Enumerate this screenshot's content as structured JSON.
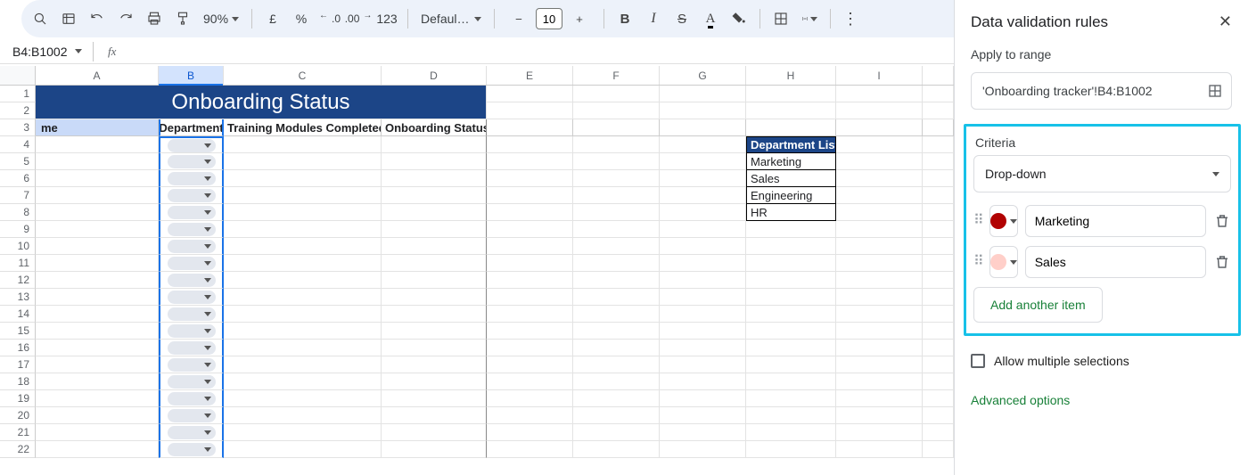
{
  "toolbar": {
    "zoom": "90%",
    "currency": "£",
    "percent": "%",
    "dec_dec": ".0",
    "dec_inc": ".00",
    "numfmt": "123",
    "font": "Defaul…",
    "font_size": "10"
  },
  "namebox": "B4:B1002",
  "sheet": {
    "columns": [
      "A",
      "B",
      "C",
      "D",
      "E",
      "F",
      "G",
      "H",
      "I"
    ],
    "selected_col": "B",
    "title": "Onboarding Status",
    "headers": {
      "a": "me",
      "b": "Department",
      "c": "Training Modules Completed",
      "d": "Onboarding Status"
    },
    "dept_list_header": "Department List",
    "dept_list": [
      "Marketing",
      "Sales",
      "Engineering",
      "HR"
    ]
  },
  "panel": {
    "title": "Data validation rules",
    "apply_label": "Apply to range",
    "range": "'Onboarding tracker'!B4:B1002",
    "criteria_label": "Criteria",
    "criteria_value": "Drop-down",
    "item1": "Marketing",
    "item2": "Sales",
    "add_item": "Add another item",
    "allow_multiple": "Allow multiple selections",
    "advanced": "Advanced options"
  }
}
